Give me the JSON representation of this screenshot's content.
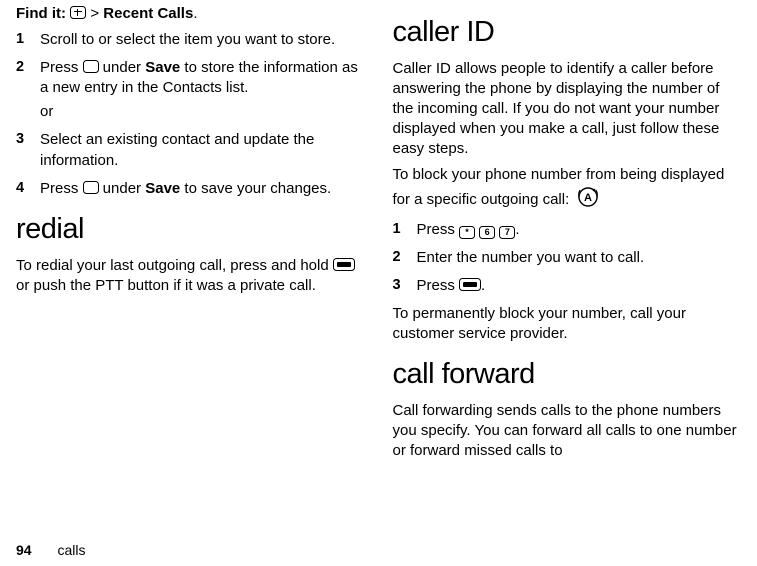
{
  "left": {
    "findit_label": "Find it:",
    "findit_gt": ">",
    "findit_path": "Recent Calls",
    "findit_period": ".",
    "step1_num": "1",
    "step1_text": "Scroll to or select the item you want to store.",
    "step2_num": "2",
    "step2_a": "Press ",
    "step2_save": "Save",
    "step2_b": " to store the information as a new entry in the Contacts list.",
    "step2_under": " under ",
    "or_text": "or",
    "step3_num": "3",
    "step3_text": "Select an existing contact and update the information.",
    "step4_num": "4",
    "step4_a": "Press ",
    "step4_under": " under ",
    "step4_save": "Save",
    "step4_b": " to save your changes.",
    "redial_heading": "redial",
    "redial_a": "To redial your last outgoing call, press and hold ",
    "redial_b": " or push the PTT button if it was a private call."
  },
  "right": {
    "callerid_heading": "caller ID",
    "callerid_p1": "Caller ID allows people to identify a caller before answering the phone by displaying the number of the incoming call. If you do not want your number displayed when you make a call, just follow these easy steps.",
    "callerid_p2": "To block your phone number from being displayed for a specific outgoing call:",
    "s1_num": "1",
    "s1_a": "Press ",
    "s1_b": ".",
    "key_star": "*",
    "key_6": "6",
    "key_7": "7",
    "s2_num": "2",
    "s2_text": "Enter the number you want to call.",
    "s3_num": "3",
    "s3_a": "Press ",
    "s3_b": ".",
    "callerid_p3": "To permanently block your number, call your customer service provider.",
    "callfwd_heading": "call forward",
    "callfwd_p1": "Call forwarding sends calls to the phone numbers you specify. You can forward all calls to one number or forward missed calls to"
  },
  "footer": {
    "page": "94",
    "section": "calls"
  }
}
